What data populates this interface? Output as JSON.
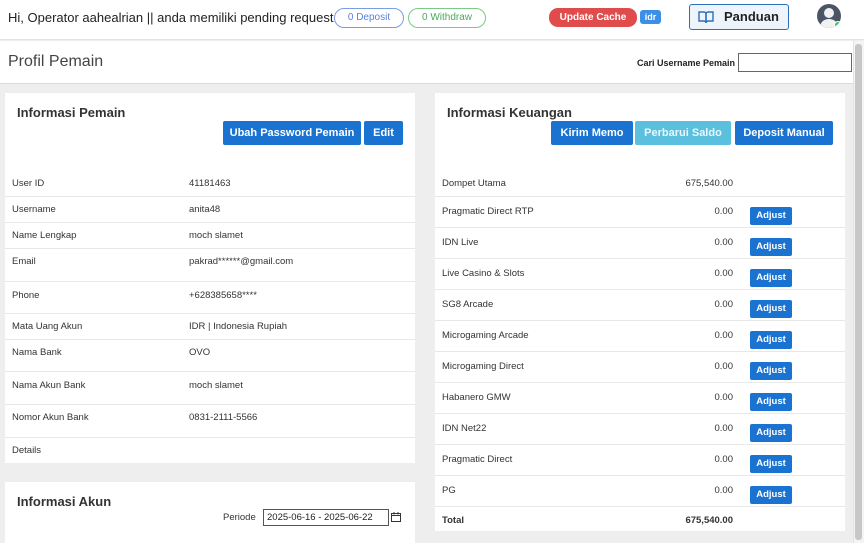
{
  "header": {
    "greeting": "Hi, Operator aahealrian || anda memiliki pending request:",
    "deposit_pill": "0 Deposit",
    "withdraw_pill": "0 Withdraw",
    "update_cache": "Update Cache",
    "currency_badge": "idr",
    "guide_button": "Panduan",
    "guide_icon": "book-icon",
    "avatar_icon": "user-avatar-icon",
    "colors": {
      "danger": "#e04b4b",
      "primary": "#1a73d1",
      "info": "#5bc0de",
      "online": "#3cc45a"
    }
  },
  "subheader": {
    "title": "Profil Pemain",
    "search_label": "Cari Username Pemain",
    "search_value": ""
  },
  "player_info": {
    "title": "Informasi Pemain",
    "change_password_button": "Ubah Password Pemain",
    "edit_button": "Edit",
    "rows": [
      {
        "label": "User ID",
        "value": "41181463"
      },
      {
        "label": "Username",
        "value": "anita48"
      },
      {
        "label": "Name Lengkap",
        "value": "moch slamet"
      },
      {
        "label": "Email",
        "value": "pakrad******@gmail.com"
      },
      {
        "label": "Phone",
        "value": "+628385658****"
      },
      {
        "label": "Mata Uang Akun",
        "value": "IDR | Indonesia Rupiah"
      },
      {
        "label": "Nama Bank",
        "value": "OVO"
      },
      {
        "label": "Nama Akun Bank",
        "value": "moch slamet"
      },
      {
        "label": "Nomor Akun Bank",
        "value": "0831-2111-5566"
      },
      {
        "label": "Details",
        "value": ""
      }
    ]
  },
  "finance_info": {
    "title": "Informasi Keuangan",
    "memo_button": "Kirim Memo",
    "refresh_button": "Perbarui Saldo",
    "manual_deposit_button": "Deposit Manual",
    "adjust_label": "Adjust",
    "rows": [
      {
        "label": "Dompet Utama",
        "value": "675,540.00"
      },
      {
        "label": "Pragmatic Direct RTP",
        "value": "0.00"
      },
      {
        "label": "IDN Live",
        "value": "0.00"
      },
      {
        "label": "Live Casino & Slots",
        "value": "0.00"
      },
      {
        "label": "SG8 Arcade",
        "value": "0.00"
      },
      {
        "label": "Microgaming Arcade",
        "value": "0.00"
      },
      {
        "label": "Microgaming Direct",
        "value": "0.00"
      },
      {
        "label": "Habanero GMW",
        "value": "0.00"
      },
      {
        "label": "IDN Net22",
        "value": "0.00"
      },
      {
        "label": "Pragmatic Direct",
        "value": "0.00"
      },
      {
        "label": "PG",
        "value": "0.00"
      }
    ],
    "total_label": "Total",
    "total_value": "675,540.00"
  },
  "account_info": {
    "title": "Informasi Akun",
    "periode_label": "Periode",
    "periode_value": "2025-06-16 - 2025-06-22",
    "calendar_icon": "calendar-icon"
  }
}
